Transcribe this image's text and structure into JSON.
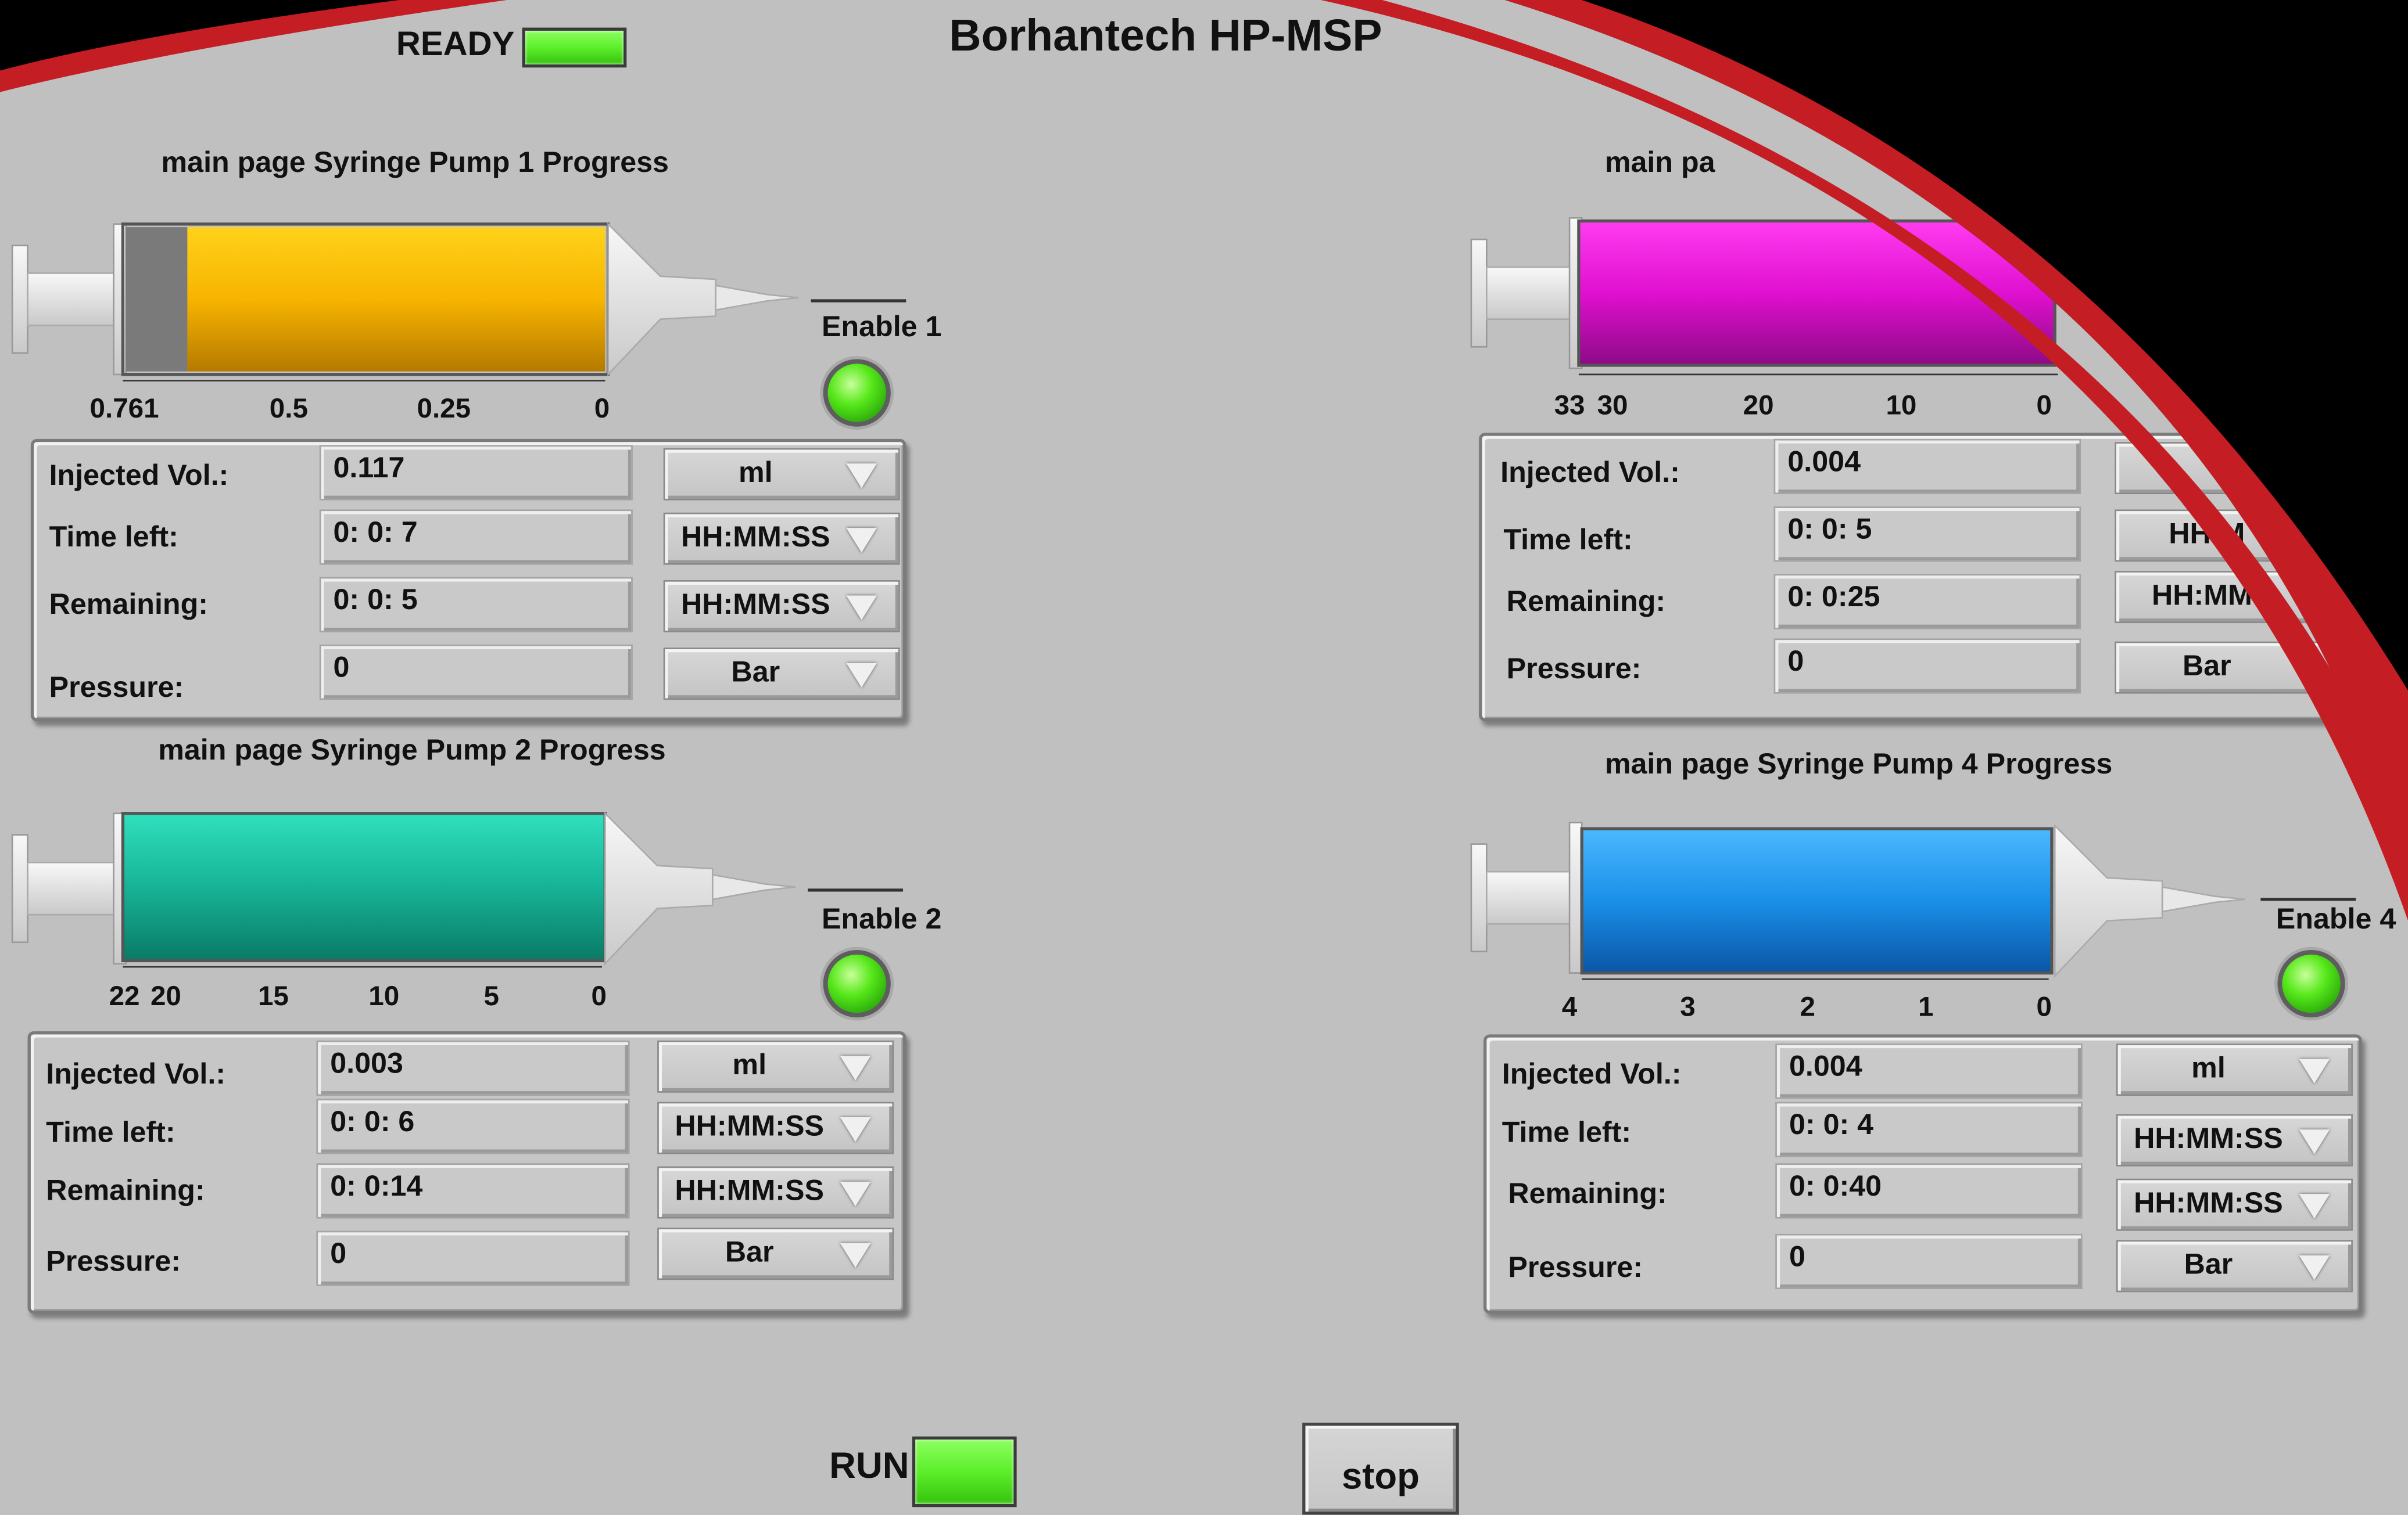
{
  "app": {
    "title": "Borhantech HP-MSP",
    "ready_label": "READY",
    "run_label": "RUN",
    "stop_label": "stop"
  },
  "pumps": [
    {
      "title": "main page Syringe Pump 1 Progress",
      "enable_label": "Enable 1",
      "color": "#f7b400",
      "ticks": [
        "0.761",
        "0.5",
        "0.25",
        "0"
      ],
      "injected": "0.117",
      "injected_unit": "ml",
      "time_left": "0: 0: 7",
      "time_left_unit": "HH:MM:SS",
      "remaining": "0: 0: 5",
      "remaining_unit": "HH:MM:SS",
      "pressure": "0",
      "pressure_unit": "Bar"
    },
    {
      "title": "main page Syringe Pump 2 Progress",
      "enable_label": "Enable 2",
      "color": "#17b397",
      "ticks": [
        "22",
        "20",
        "15",
        "10",
        "5",
        "0"
      ],
      "injected": "0.003",
      "injected_unit": "ml",
      "time_left": "0: 0: 6",
      "time_left_unit": "HH:MM:SS",
      "remaining": "0: 0:14",
      "remaining_unit": "HH:MM:SS",
      "pressure": "0",
      "pressure_unit": "Bar"
    },
    {
      "title": "main pa",
      "color": "#e010d0",
      "ticks": [
        "33",
        "30",
        "20",
        "10",
        "0"
      ],
      "injected": "0.004",
      "time_left": "0: 0: 5",
      "time_left_unit": "HH:M",
      "remaining": "0: 0:25",
      "remaining_unit": "HH:MM:",
      "pressure": "0",
      "pressure_unit": "Bar"
    },
    {
      "title": "main page Syringe Pump 4 Progress",
      "enable_label": "Enable 4",
      "color": "#1a90e8",
      "ticks": [
        "4",
        "3",
        "2",
        "1",
        "0"
      ],
      "injected": "0.004",
      "injected_unit": "ml",
      "time_left": "0: 0: 4",
      "time_left_unit": "HH:MM:SS",
      "remaining": "0: 0:40",
      "remaining_unit": "HH:MM:SS",
      "pressure": "0",
      "pressure_unit": "Bar"
    }
  ],
  "labels": {
    "injected": "Injected Vol.:",
    "time_left": "Time left:",
    "remaining": "Remaining:",
    "pressure": "Pressure:"
  }
}
